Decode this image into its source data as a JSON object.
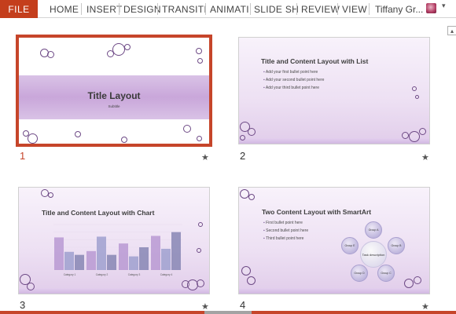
{
  "ribbon": {
    "file_label": "FILE",
    "tabs": [
      "HOME",
      "INSERT",
      "DESIGN",
      "TRANSITI",
      "ANIMATI",
      "SLIDE SH",
      "REVIEW",
      "VIEW"
    ],
    "user_name": "Tiffany Gr...",
    "user_caret": "▾",
    "collapse_glyph": "▴"
  },
  "slides": [
    {
      "number": "1",
      "selected": true,
      "title": "Title Layout",
      "subtitle": "Subtitle",
      "star": "★"
    },
    {
      "number": "2",
      "title": "Title and Content Layout with List",
      "bullets": [
        "Add your first bullet point here",
        "Add your second bullet point here",
        "Add your third bullet point here"
      ],
      "star": "★"
    },
    {
      "number": "3",
      "title": "Title and Content Layout with Chart",
      "star": "★"
    },
    {
      "number": "4",
      "title": "Two Content Layout with SmartArt",
      "bullets": [
        "First bullet point here",
        "Second bullet point here",
        "Third bullet point here"
      ],
      "smartart": {
        "center": "Task description",
        "nodes": [
          "Group A",
          "Group B",
          "Group C",
          "Group D",
          "Group E"
        ]
      },
      "star": "★"
    }
  ],
  "chart_data": {
    "type": "bar",
    "categories": [
      "Category 1",
      "Category 2",
      "Category 3",
      "Category 4"
    ],
    "series": [
      {
        "values": [
          4.3,
          2.5,
          3.5,
          4.5
        ],
        "color": "#b999d2"
      },
      {
        "values": [
          2.4,
          4.4,
          1.8,
          2.8
        ],
        "color": "#9fa0cf"
      },
      {
        "values": [
          2.0,
          2.0,
          3.0,
          5.0
        ],
        "color": "#8786b4"
      }
    ],
    "ylim": [
      0,
      6
    ],
    "grid": true
  }
}
